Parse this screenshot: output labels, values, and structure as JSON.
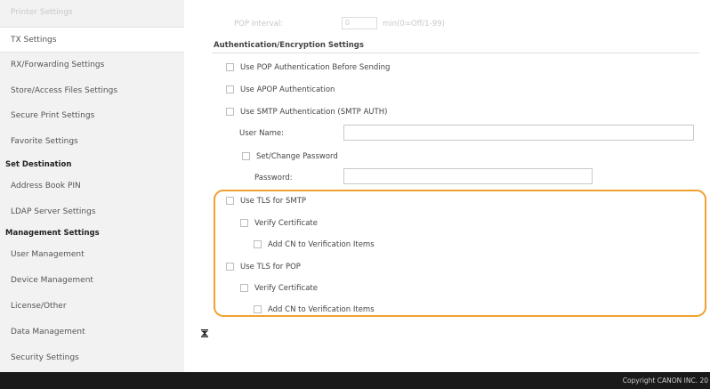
{
  "sidebar": {
    "items": [
      {
        "label": "Printer Settings"
      },
      {
        "label": "TX Settings"
      },
      {
        "label": "RX/Forwarding Settings"
      },
      {
        "label": "Store/Access Files Settings"
      },
      {
        "label": "Secure Print Settings"
      },
      {
        "label": "Favorite Settings"
      },
      {
        "label": "Address Book PIN"
      },
      {
        "label": "LDAP Server Settings"
      },
      {
        "label": "User Management"
      },
      {
        "label": "Device Management"
      },
      {
        "label": "License/Other"
      },
      {
        "label": "Data Management"
      },
      {
        "label": "Security Settings"
      }
    ],
    "headers": {
      "set_destination": "Set Destination",
      "management_settings": "Management Settings"
    }
  },
  "main": {
    "pop_interval": {
      "label": "POP Interval:",
      "value": "0",
      "unit": "min(0=Off/1-99)"
    },
    "section_title": "Authentication/Encryption Settings",
    "options": {
      "pop_auth": "Use POP Authentication Before Sending",
      "apop_auth": "Use APOP Authentication",
      "smtp_auth": "Use SMTP Authentication (SMTP AUTH)",
      "user_name": "User Name:",
      "set_change_password": "Set/Change Password",
      "password": "Password:",
      "tls_smtp": "Use TLS for SMTP",
      "verify_cert_smtp": "Verify Certificate",
      "add_cn_smtp": "Add CN to Verification Items",
      "tls_pop": "Use TLS for POP",
      "verify_cert_pop": "Verify Certificate",
      "add_cn_pop": "Add CN to Verification Items"
    },
    "highlight_color": "#f0a030"
  },
  "footer": {
    "copyright": "Copyright CANON INC. 20"
  }
}
